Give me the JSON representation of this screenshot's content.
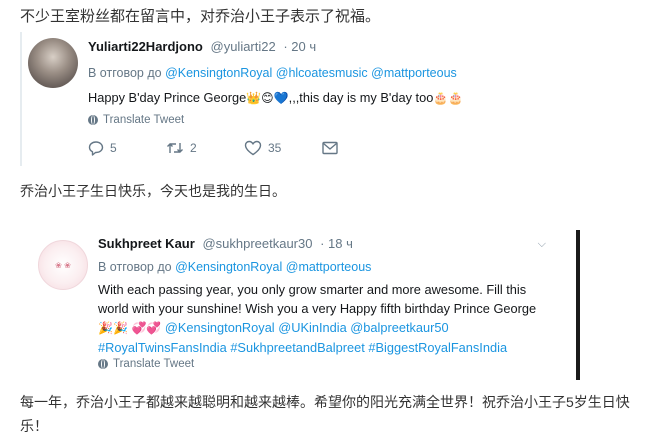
{
  "intro_text": "不少王室粉丝都在留言中，对乔治小王子表示了祝福。",
  "caption1": "乔治小王子生日快乐，今天也是我的生日。",
  "caption2": "每一年，乔治小王子都越来越聪明和越来越棒。希望你的阳光充满全世界！祝乔治小王子5岁生日快乐！",
  "tweet1": {
    "name": "Yuliarti22Hardjono",
    "handle": "@yuliarti22",
    "time": "· 20 ч",
    "reply_prefix": "В отговор до",
    "mentions": [
      "@KensingtonRoyal",
      "@hlcoatesmusic",
      "@mattporteous"
    ],
    "text_start": "Happy B'day Prince George",
    "emojis_mid": "👑😊💙",
    "text_end": ",,,this day is my B'day too",
    "emojis_end": "🎂🎂",
    "translate_label": "Translate Tweet",
    "reply_count": "5",
    "retweet_count": "2",
    "like_count": "35"
  },
  "tweet2": {
    "name": "Sukhpreet Kaur",
    "handle": "@sukhpreetkaur30",
    "time": "· 18 ч",
    "reply_prefix": "В отговор до",
    "mentions": [
      "@KensingtonRoyal",
      "@mattporteous"
    ],
    "text_main": "With each passing year, you only grow smarter and more awesome. Fill this world with your sunshine! Wish you a very Happy fifth birthday Prince George",
    "emojis_a": "🎉🎉",
    "emojis_b": "💞💞",
    "tags": [
      "@KensingtonRoyal",
      "@UKinIndia",
      "@balpreetkaur50",
      "#RoyalTwinsFansIndia",
      "#SukhpreetandBalpreet",
      "#BiggestRoyalFansIndia"
    ],
    "translate_label": "Translate Tweet"
  },
  "colors": {
    "link": "#1b95e0",
    "secondary": "#657786",
    "text": "#14171a"
  }
}
